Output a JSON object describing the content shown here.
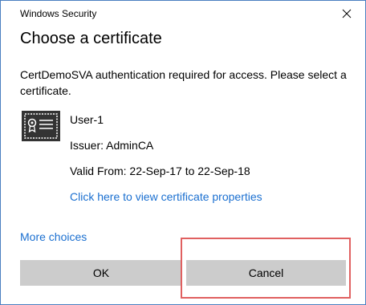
{
  "window": {
    "title": "Windows Security",
    "close_icon": "close-icon"
  },
  "dialog": {
    "heading": "Choose a certificate",
    "message": "CertDemoSVA authentication required for access. Please select a certificate."
  },
  "certificate": {
    "icon": "certificate-icon",
    "name": "User-1",
    "issuer": "Issuer: AdminCA",
    "valid": "Valid From: 22-Sep-17 to 22-Sep-18",
    "properties_link": "Click here to view certificate properties"
  },
  "more_choices": "More choices",
  "buttons": {
    "ok": "OK",
    "cancel": "Cancel"
  },
  "colors": {
    "link": "#1a6fd0",
    "button_bg": "#cccccc",
    "window_border": "#4a7fc1",
    "highlight": "#e06060"
  }
}
